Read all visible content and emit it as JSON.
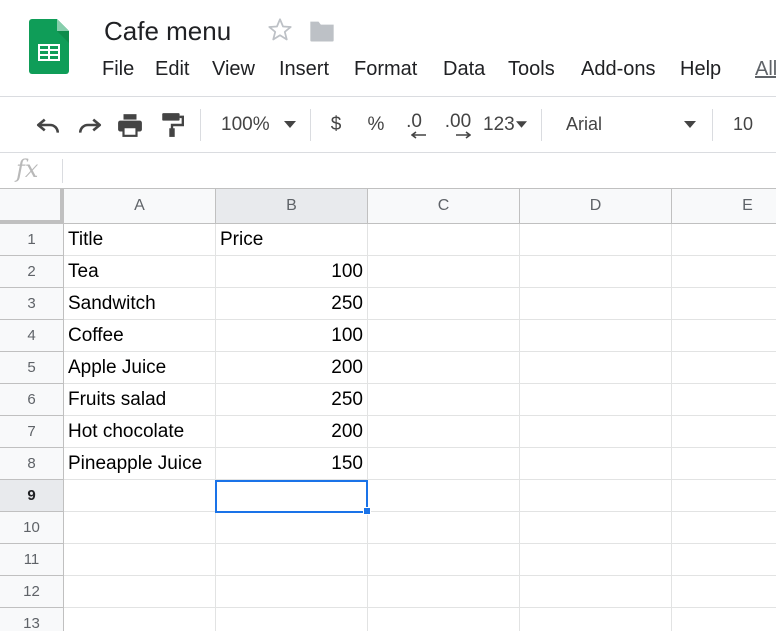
{
  "app": {
    "doc_title": "Cafe menu"
  },
  "menu": [
    "File",
    "Edit",
    "View",
    "Insert",
    "Format",
    "Data",
    "Tools",
    "Add-ons",
    "Help",
    "All"
  ],
  "toolbar": {
    "zoom": "100%",
    "currency": "$",
    "percent": "%",
    "decrease_decimal": ".0",
    "increase_decimal": ".00",
    "more_formats": "123",
    "font": "Arial",
    "font_size": "10"
  },
  "formula_bar": {
    "label": "fx",
    "value": ""
  },
  "sheet": {
    "columns": [
      "A",
      "B",
      "C",
      "D",
      "E"
    ],
    "rows": [
      "1",
      "2",
      "3",
      "4",
      "5",
      "6",
      "7",
      "8",
      "9",
      "10",
      "11",
      "12",
      "13"
    ],
    "cells": [
      [
        "Title",
        "Price"
      ],
      [
        "Tea",
        "100"
      ],
      [
        "Sandwitch",
        "250"
      ],
      [
        "Coffee",
        "100"
      ],
      [
        "Apple Juice",
        "200"
      ],
      [
        "Fruits salad",
        "250"
      ],
      [
        "Hot chocolate",
        "200"
      ],
      [
        "Pineapple Juice",
        "150"
      ]
    ],
    "selected_cell": "B9"
  },
  "colors": {
    "accent": "#1a73e8",
    "logo_green": "#0f9d58",
    "header_bg": "#f8f9fa",
    "grid_line": "#e2e3e3"
  }
}
